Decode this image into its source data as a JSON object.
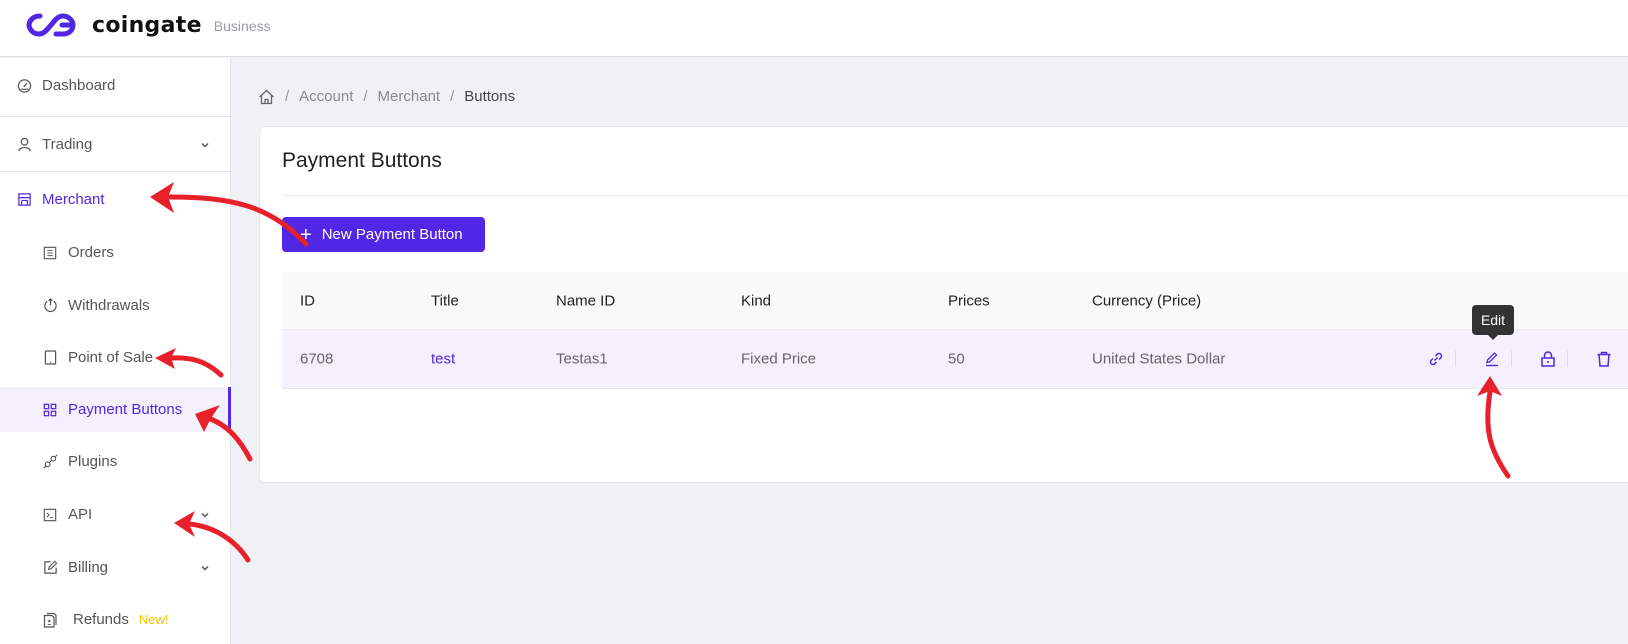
{
  "header": {
    "brand": "coingate",
    "brand_sub": "Business"
  },
  "sidebar": {
    "items": [
      {
        "label": "Dashboard",
        "icon": "dashboard-gauge-icon"
      },
      {
        "label": "Trading",
        "icon": "user-icon",
        "expandable": true
      },
      {
        "label": "Merchant",
        "icon": "store-icon",
        "expanded": true
      },
      {
        "label": "Orders",
        "icon": "list-icon"
      },
      {
        "label": "Withdrawals",
        "icon": "power-arrow-icon"
      },
      {
        "label": "Point of Sale",
        "icon": "tablet-icon"
      },
      {
        "label": "Payment Buttons",
        "icon": "grid-icon",
        "active": true
      },
      {
        "label": "Plugins",
        "icon": "plug-icon"
      },
      {
        "label": "API",
        "icon": "terminal-icon",
        "expandable": true
      },
      {
        "label": "Billing",
        "icon": "edit-square-icon",
        "expandable": true
      },
      {
        "label": "Refunds",
        "icon": "document-stack-icon",
        "badge": "New!"
      }
    ]
  },
  "breadcrumb": {
    "home_icon": "home-icon",
    "items": [
      "Account",
      "Merchant",
      "Buttons"
    ],
    "separator": "/"
  },
  "page": {
    "title": "Payment Buttons",
    "new_button_label": "New Payment Button"
  },
  "table": {
    "columns": [
      "ID",
      "Title",
      "Name ID",
      "Kind",
      "Prices",
      "Currency (Price)"
    ],
    "rows": [
      {
        "id": "6708",
        "title": "test",
        "name_id": "Testas1",
        "kind": "Fixed Price",
        "prices": "50",
        "currency": "United States Dollar",
        "actions": [
          "link-icon",
          "edit-icon",
          "lock-icon",
          "trash-icon"
        ]
      }
    ]
  },
  "tooltip": {
    "text": "Edit"
  },
  "colors": {
    "accent": "#5126e5",
    "active_bg": "#f4f0fd",
    "badge": "#f2c200",
    "annotation": "#e8202a",
    "page_bg": "#f0f1f5"
  }
}
